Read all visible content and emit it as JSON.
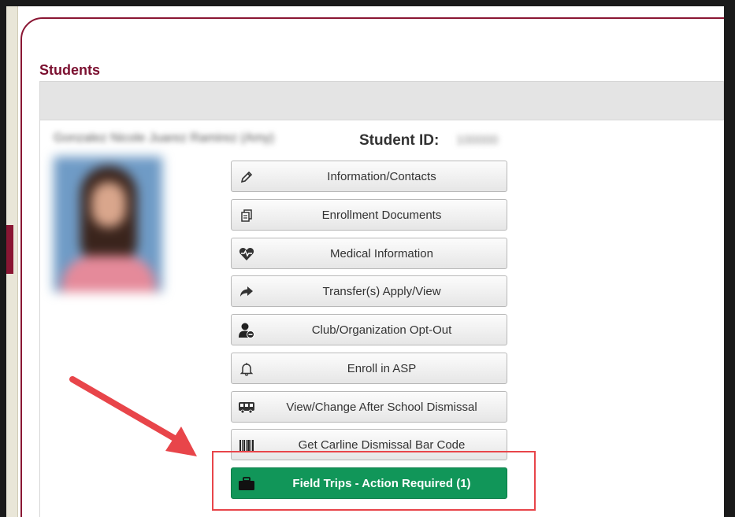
{
  "page": {
    "section_title": "Students"
  },
  "student": {
    "name": "Gonzalez Nicole Juarez Ramirez (Amy)",
    "id_label": "Student ID:",
    "id_value": "100000"
  },
  "buttons": [
    {
      "label": "Information/Contacts",
      "icon": "pencil-icon"
    },
    {
      "label": "Enrollment Documents",
      "icon": "documents-icon"
    },
    {
      "label": "Medical Information",
      "icon": "heartbeat-icon"
    },
    {
      "label": "Transfer(s) Apply/View",
      "icon": "share-arrow-icon"
    },
    {
      "label": "Club/Organization Opt-Out",
      "icon": "user-minus-icon"
    },
    {
      "label": "Enroll in ASP",
      "icon": "bell-icon"
    },
    {
      "label": "View/Change After School Dismissal",
      "icon": "bus-icon"
    },
    {
      "label": "Get Carline Dismissal Bar Code",
      "icon": "barcode-icon"
    },
    {
      "label": "Field Trips - Action Required (1)",
      "icon": "briefcase-icon"
    }
  ],
  "colors": {
    "brand": "#8a1633",
    "action_required": "#119659",
    "annotation": "#e8454a"
  }
}
